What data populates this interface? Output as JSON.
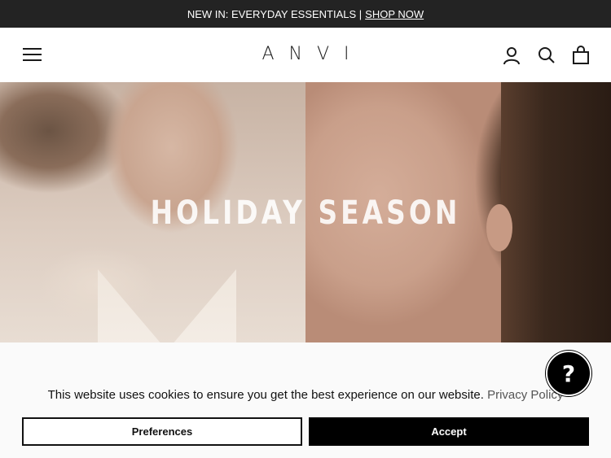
{
  "announcement": {
    "text": "NEW IN: EVERYDAY ESSENTIALS |",
    "link": "SHOP NOW"
  },
  "header": {
    "logo": "ANVI",
    "icons": [
      "menu-icon",
      "account-icon",
      "search-icon",
      "cart-icon"
    ]
  },
  "hero": {
    "title": "HOLIDAY SEASON"
  },
  "cookie": {
    "message": "This website uses cookies to ensure you get the best experience on our website.",
    "policy_link": "Privacy Policy",
    "preferences_label": "Preferences",
    "accept_label": "Accept"
  },
  "help": {
    "glyph": "?"
  },
  "colors": {
    "announcement_bg": "#232323",
    "accept_bg": "#000000",
    "help_bg": "#000000"
  }
}
